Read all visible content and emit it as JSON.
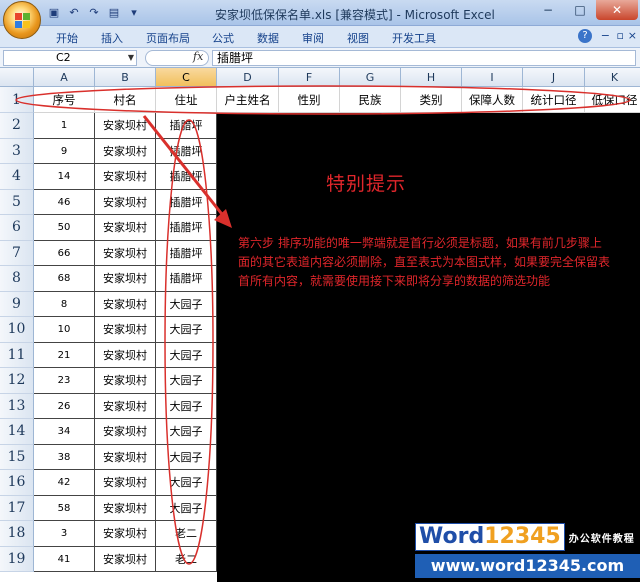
{
  "window": {
    "title": "安家坝低保保名单.xls  [兼容模式] - Microsoft Excel",
    "controls": [
      "−",
      "□",
      "✕"
    ]
  },
  "ribbon": {
    "tabs": [
      "开始",
      "插入",
      "页面布局",
      "公式",
      "数据",
      "审阅",
      "视图",
      "开发工具"
    ],
    "help": "?"
  },
  "formula_bar": {
    "name_box": "C2",
    "fx": "fx",
    "content": "插腊坪"
  },
  "columns": [
    "A",
    "B",
    "C",
    "D",
    "F",
    "G",
    "H",
    "I",
    "J",
    "K"
  ],
  "header_row": [
    "序号",
    "村名",
    "住址",
    "户主姓名",
    "性别",
    "民族",
    "类别",
    "保障人数",
    "统计口径",
    "低保口径"
  ],
  "rows": [
    {
      "num": "2",
      "a": "1",
      "b": "安家坝村",
      "c": "插腊坪"
    },
    {
      "num": "3",
      "a": "9",
      "b": "安家坝村",
      "c": "插腊坪"
    },
    {
      "num": "4",
      "a": "14",
      "b": "安家坝村",
      "c": "插腊坪"
    },
    {
      "num": "5",
      "a": "46",
      "b": "安家坝村",
      "c": "插腊坪"
    },
    {
      "num": "6",
      "a": "50",
      "b": "安家坝村",
      "c": "插腊坪"
    },
    {
      "num": "7",
      "a": "66",
      "b": "安家坝村",
      "c": "插腊坪"
    },
    {
      "num": "8",
      "a": "68",
      "b": "安家坝村",
      "c": "插腊坪"
    },
    {
      "num": "9",
      "a": "8",
      "b": "安家坝村",
      "c": "大园子"
    },
    {
      "num": "10",
      "a": "10",
      "b": "安家坝村",
      "c": "大园子"
    },
    {
      "num": "11",
      "a": "21",
      "b": "安家坝村",
      "c": "大园子"
    },
    {
      "num": "12",
      "a": "23",
      "b": "安家坝村",
      "c": "大园子"
    },
    {
      "num": "13",
      "a": "26",
      "b": "安家坝村",
      "c": "大园子"
    },
    {
      "num": "14",
      "a": "34",
      "b": "安家坝村",
      "c": "大园子"
    },
    {
      "num": "15",
      "a": "38",
      "b": "安家坝村",
      "c": "大园子"
    },
    {
      "num": "16",
      "a": "42",
      "b": "安家坝村",
      "c": "大园子"
    },
    {
      "num": "17",
      "a": "58",
      "b": "安家坝村",
      "c": "大园子"
    },
    {
      "num": "18",
      "a": "3",
      "b": "安家坝村",
      "c": "老二"
    },
    {
      "num": "19",
      "a": "41",
      "b": "安家坝村",
      "c": "老二"
    }
  ],
  "row1_num": "1",
  "tip": {
    "title": "特别提示",
    "body": "第六步 排序功能的唯一弊端就是首行必须是标题，如果有前几步骤上面的其它表道内容必须删除，直至表式为本图式样，如果要完全保留表首所有内容，就需要使用接下来即将分享的数据的筛选功能"
  },
  "watermark": {
    "logo_word": "Word",
    "logo_num": "12345",
    "cn": "办公软件教程",
    "url": "www.word12345.com"
  },
  "colors": {
    "tip_red": "#e0262b",
    "annotation_red": "#d9302c",
    "selected_header": "#f1c05c"
  }
}
